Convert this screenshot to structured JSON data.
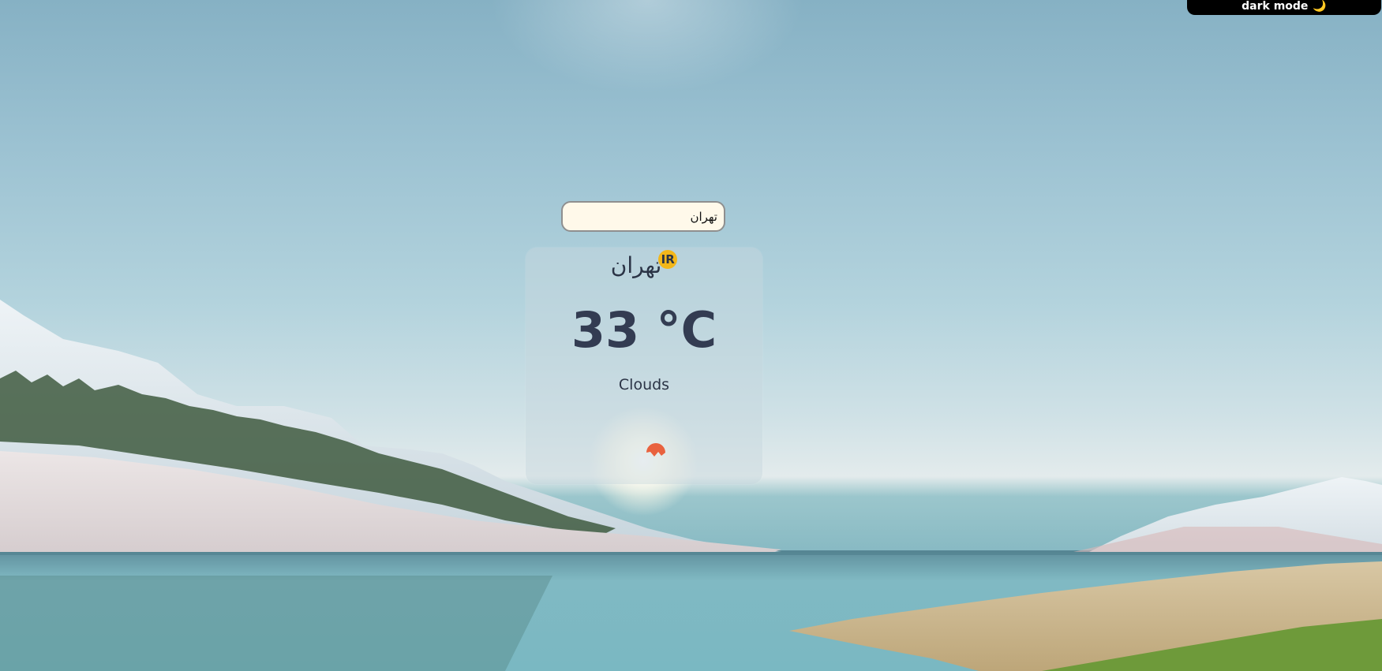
{
  "toggle": {
    "label": "dark mode",
    "icon": "🌙"
  },
  "search": {
    "value": "تهران",
    "placeholder": ""
  },
  "weather": {
    "city": "تهران",
    "country": "IR",
    "temperature": "33 °C",
    "description": "Clouds",
    "icon": "clouds-icon"
  },
  "colors": {
    "toggle_bg": "#000000",
    "country_badge": "#f3b71a",
    "text": "#2b3446",
    "temp_text": "#333c52",
    "input_bg": "#fff9ea",
    "icon_color": "#e9623e"
  }
}
